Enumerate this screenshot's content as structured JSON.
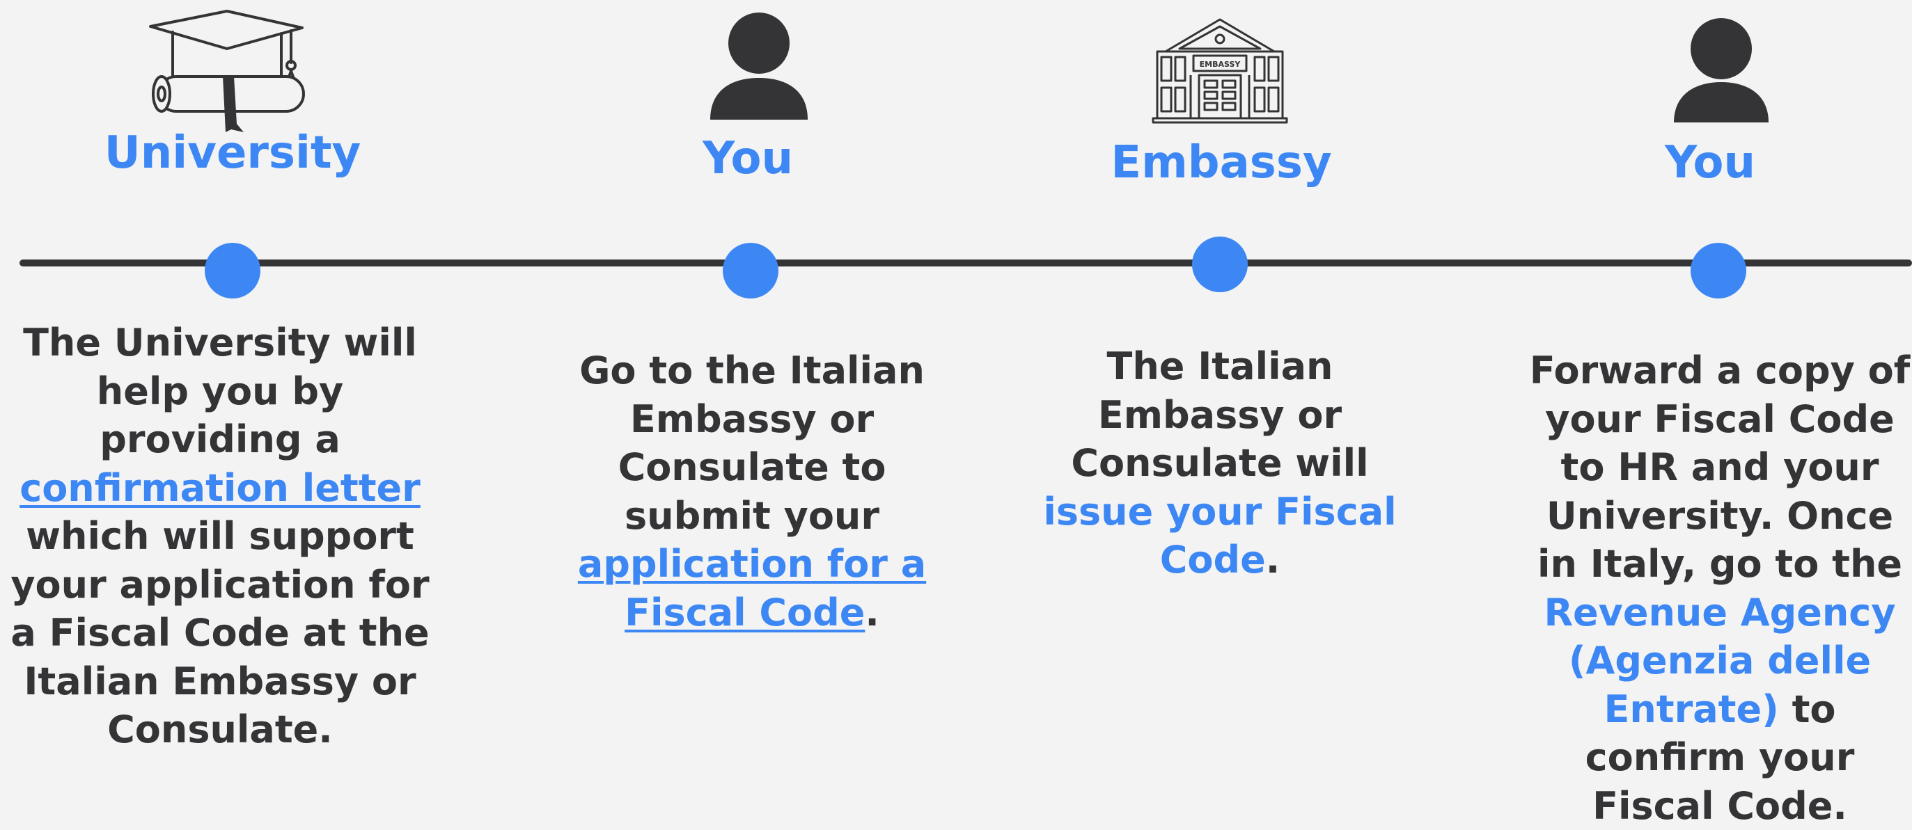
{
  "colors": {
    "accent": "#3c87f4",
    "text": "#343436",
    "line": "#343436",
    "background": "#f3f3f3"
  },
  "steps": [
    {
      "actor": "University",
      "icon": "graduation-cap-diploma-icon",
      "description": [
        [
          {
            "text": "The University will"
          }
        ],
        [
          {
            "text": "help you by"
          }
        ],
        [
          {
            "text": "providing a"
          }
        ],
        [
          {
            "text": "confirmation letter",
            "style": "link"
          }
        ],
        [
          {
            "text": "which will support"
          }
        ],
        [
          {
            "text": "your application for"
          }
        ],
        [
          {
            "text": "a Fiscal Code at the"
          }
        ],
        [
          {
            "text": "Italian Embassy or"
          }
        ],
        [
          {
            "text": "Consulate."
          }
        ]
      ]
    },
    {
      "actor": "You",
      "icon": "person-icon",
      "description": [
        [
          {
            "text": "Go to the Italian"
          }
        ],
        [
          {
            "text": "Embassy or"
          }
        ],
        [
          {
            "text": "Consulate to"
          }
        ],
        [
          {
            "text": "submit your"
          }
        ],
        [
          {
            "text": "application for a",
            "style": "link"
          }
        ],
        [
          {
            "text": "Fiscal Code",
            "style": "link"
          },
          {
            "text": "."
          }
        ]
      ]
    },
    {
      "actor": "Embassy",
      "icon": "embassy-building-icon",
      "icon_label": "EMBASSY",
      "description": [
        [
          {
            "text": "The Italian"
          }
        ],
        [
          {
            "text": "Embassy or"
          }
        ],
        [
          {
            "text": "Consulate will"
          }
        ],
        [
          {
            "text": "issue your Fiscal",
            "style": "accent"
          }
        ],
        [
          {
            "text": "Code",
            "style": "accent"
          },
          {
            "text": "."
          }
        ]
      ]
    },
    {
      "actor": "You",
      "icon": "person-icon",
      "description": [
        [
          {
            "text": "Forward a copy of"
          }
        ],
        [
          {
            "text": "your Fiscal Code"
          }
        ],
        [
          {
            "text": "to HR and your"
          }
        ],
        [
          {
            "text": "University. Once"
          }
        ],
        [
          {
            "text": "in Italy, go to the"
          }
        ],
        [
          {
            "text": "Revenue Agency",
            "style": "accent"
          }
        ],
        [
          {
            "text": "(Agenzia delle",
            "style": "accent"
          }
        ],
        [
          {
            "text": "Entrate)",
            "style": "accent"
          },
          {
            "text": " to"
          }
        ],
        [
          {
            "text": "confirm your"
          }
        ],
        [
          {
            "text": "Fiscal Code."
          }
        ]
      ]
    }
  ]
}
